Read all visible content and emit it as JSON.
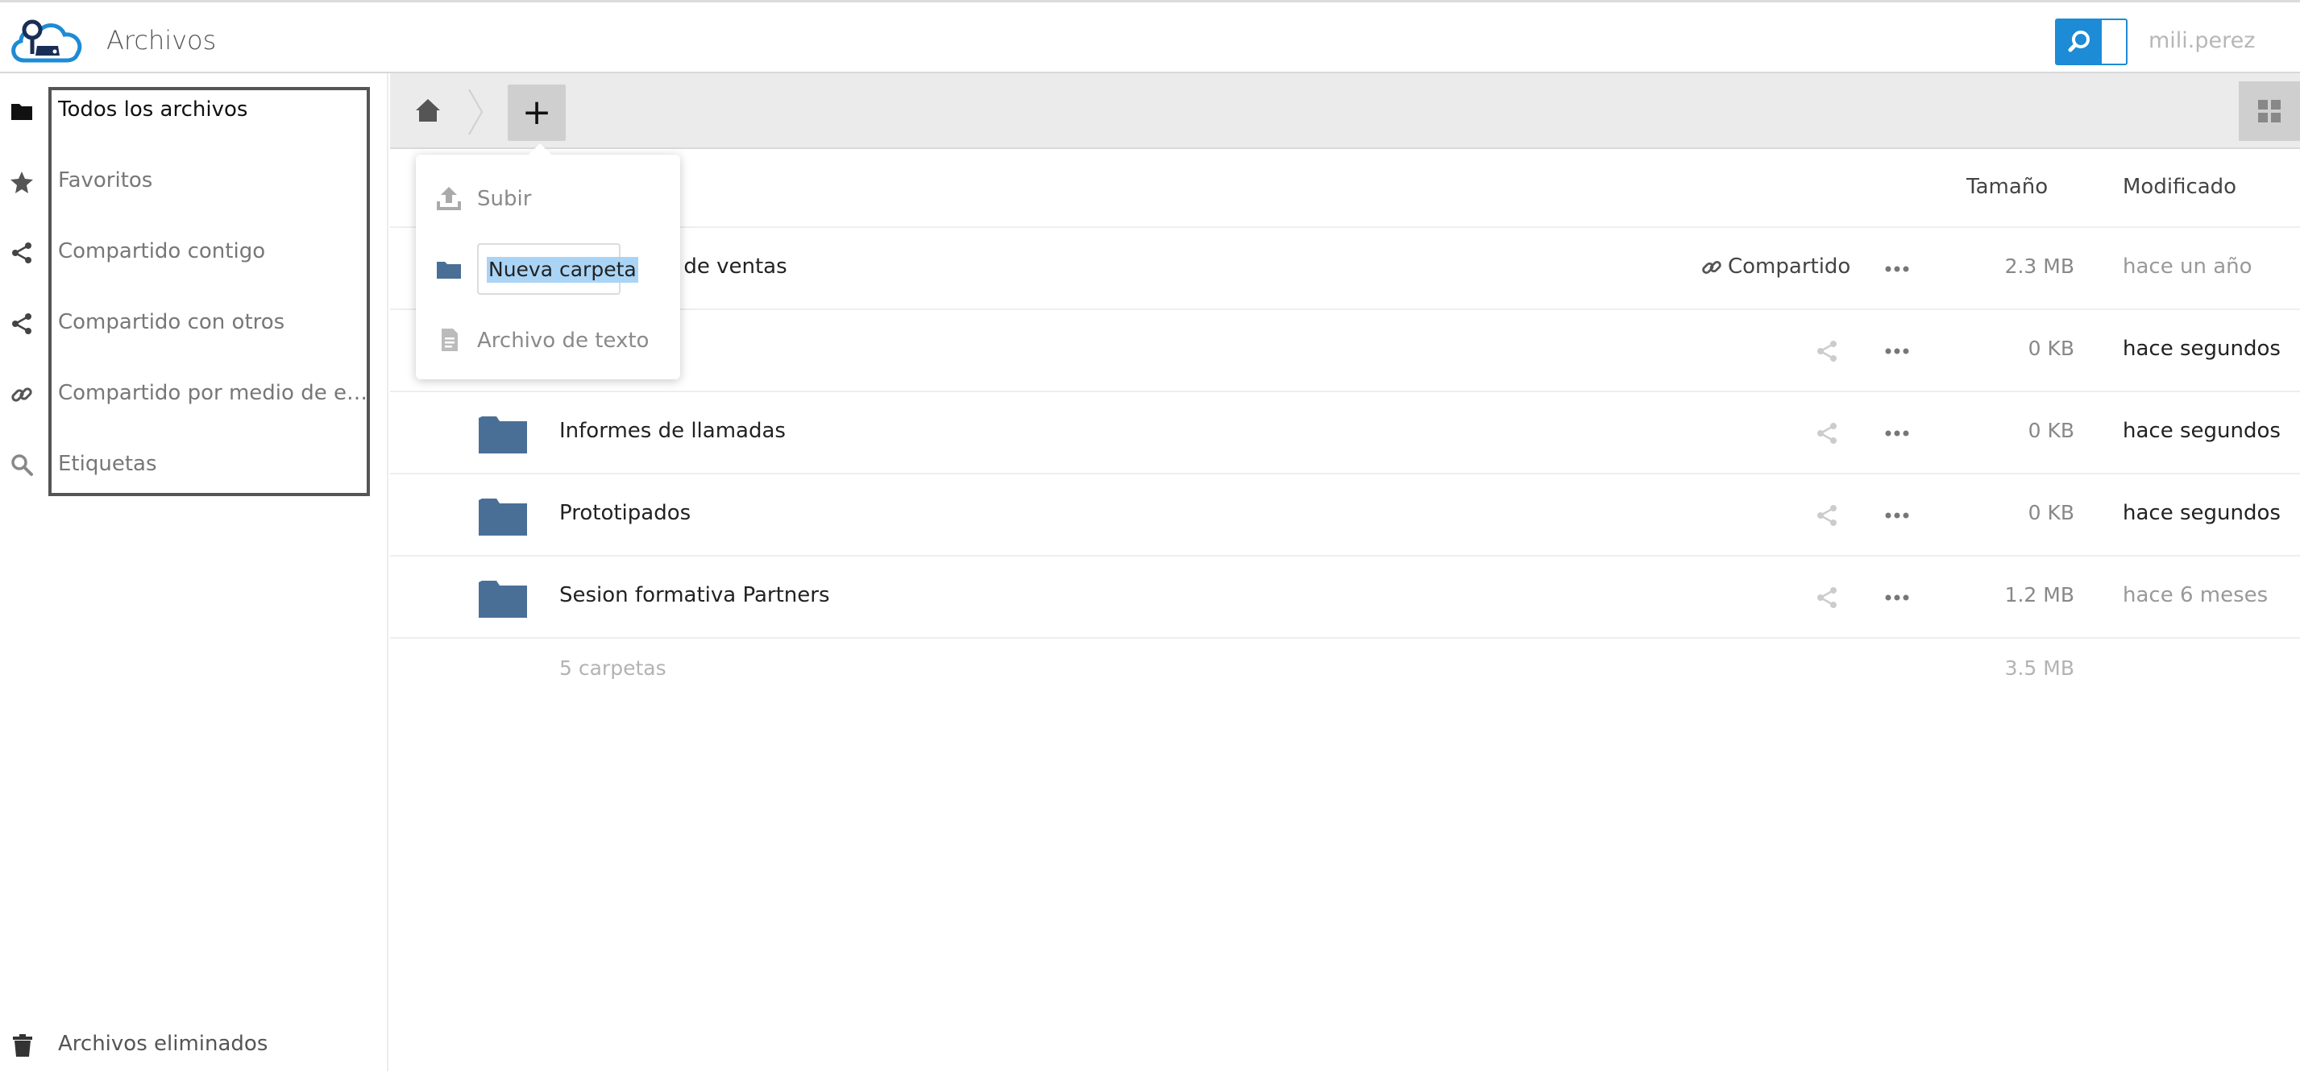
{
  "header": {
    "app_title": "Archivos",
    "user_name": "mili.perez",
    "accent_color": "#1d8bd5"
  },
  "sidebar": {
    "items": [
      {
        "label": "Todos los archivos",
        "icon": "folder-icon",
        "active": true
      },
      {
        "label": "Favoritos",
        "icon": "star-icon"
      },
      {
        "label": "Compartido contigo",
        "icon": "share-icon"
      },
      {
        "label": "Compartido con otros",
        "icon": "share-icon"
      },
      {
        "label": "Compartido por medio de enlac...",
        "icon": "link-icon"
      },
      {
        "label": "Etiquetas",
        "icon": "tag-search-icon"
      }
    ],
    "deleted_label": "Archivos eliminados"
  },
  "toolbar": {
    "new_label": "+"
  },
  "new_menu": {
    "upload_label": "Subir",
    "folder_name_value": "Nueva carpeta",
    "text_file_label": "Archivo de texto"
  },
  "files": {
    "columns": {
      "size": "Tamaño",
      "modified": "Modificado"
    },
    "rows": [
      {
        "name": "to de ventas",
        "shared_label": "Compartido",
        "size": "2.3 MB",
        "modified": "hace un año",
        "modified_color": "#999999"
      },
      {
        "name": "",
        "size": "0 KB",
        "modified": "hace segundos",
        "modified_color": "#222222"
      },
      {
        "name": "Informes de llamadas",
        "size": "0 KB",
        "modified": "hace segundos",
        "modified_color": "#222222"
      },
      {
        "name": "Prototipados",
        "size": "0 KB",
        "modified": "hace segundos",
        "modified_color": "#222222"
      },
      {
        "name": "Sesion formativa Partners",
        "size": "1.2 MB",
        "modified": "hace 6 meses",
        "modified_color": "#999999"
      }
    ],
    "summary": {
      "count": "5 carpetas",
      "total": "3.5 MB"
    },
    "folder_color": "#4a6f96"
  }
}
